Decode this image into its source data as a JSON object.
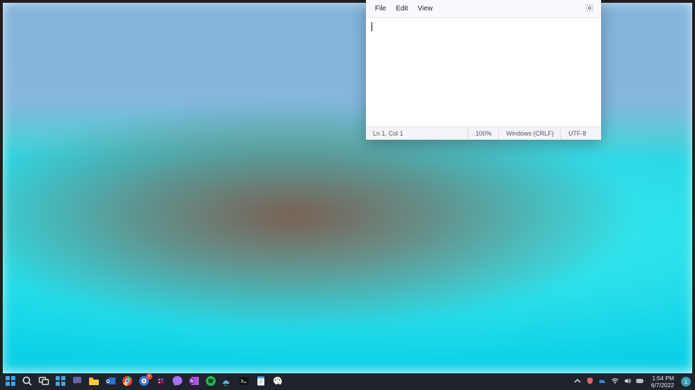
{
  "notepad": {
    "menu": {
      "file": "File",
      "edit": "Edit",
      "view": "View"
    },
    "content": "",
    "status": {
      "pos": "Ln 1, Col 1",
      "zoom": "100%",
      "eol": "Windows (CRLF)",
      "encoding": "UTF-8"
    }
  },
  "taskbar": {
    "icons": [
      {
        "name": "start",
        "kind": "windows"
      },
      {
        "name": "search",
        "kind": "search"
      },
      {
        "name": "task-view",
        "kind": "taskview"
      },
      {
        "name": "widgets",
        "kind": "widgets"
      },
      {
        "name": "chat",
        "kind": "chat"
      },
      {
        "name": "file-explorer",
        "kind": "explorer"
      },
      {
        "name": "outlook",
        "kind": "outlook"
      },
      {
        "name": "chrome",
        "kind": "chrome"
      },
      {
        "name": "copilot",
        "kind": "copilot",
        "badge": "•"
      },
      {
        "name": "slack",
        "kind": "slack"
      },
      {
        "name": "messenger",
        "kind": "messenger"
      },
      {
        "name": "onenote",
        "kind": "onenote"
      },
      {
        "name": "spotify",
        "kind": "spotify"
      },
      {
        "name": "weather",
        "kind": "weather"
      },
      {
        "name": "terminal",
        "kind": "terminal"
      },
      {
        "name": "notepad",
        "kind": "notepad"
      },
      {
        "name": "paint",
        "kind": "paint"
      }
    ],
    "badges": {
      "copilot": "•"
    }
  },
  "systray": {
    "time": "1:54 PM",
    "date": "6/7/2022",
    "notif_count": "1"
  }
}
